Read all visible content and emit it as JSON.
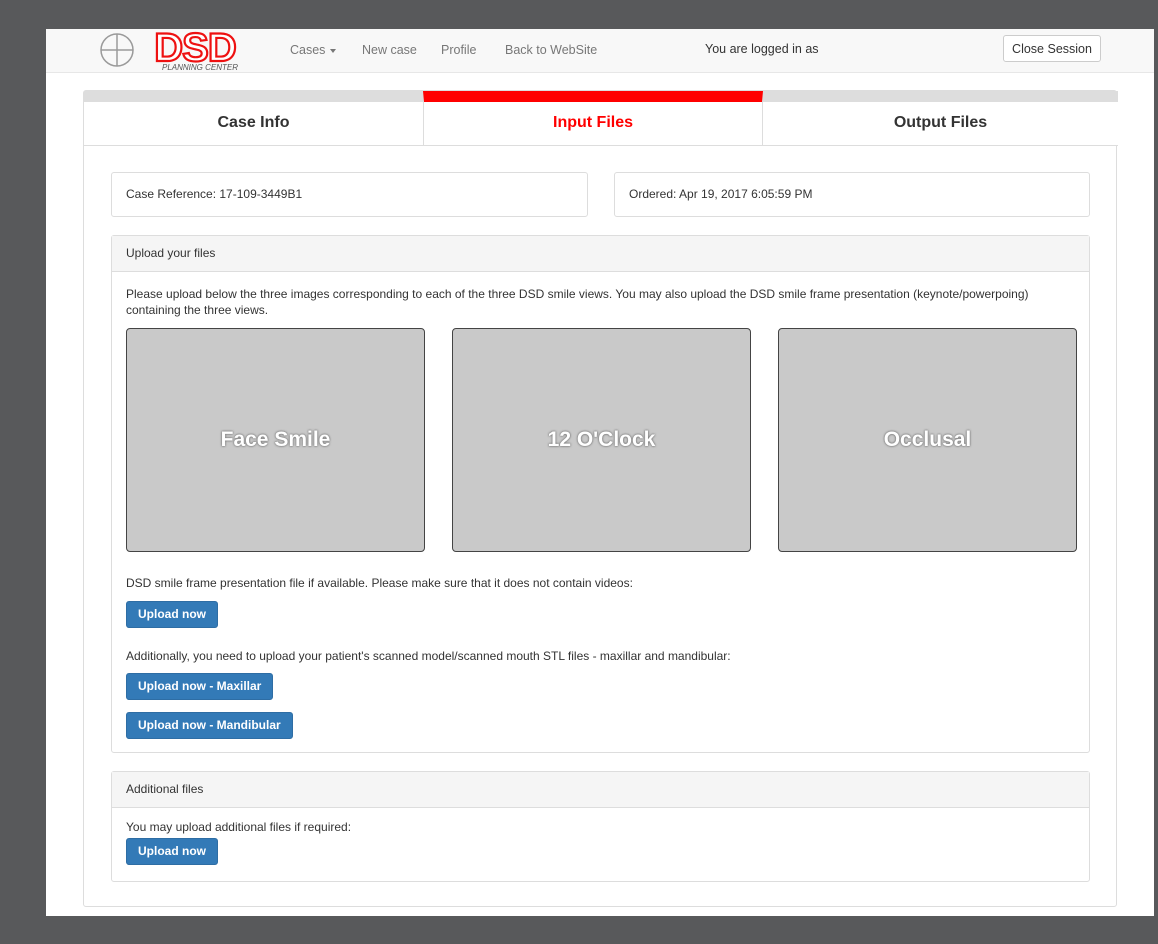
{
  "navbar": {
    "logo_text": "DSD",
    "logo_subtext": "PLANNING CENTER",
    "cases_label": "Cases",
    "new_case_label": "New case",
    "profile_label": "Profile",
    "back_label": "Back to WebSite",
    "logged_in_text": "You are logged in as",
    "close_session_label": "Close Session"
  },
  "tabs": [
    {
      "label": "Case Info",
      "active": false
    },
    {
      "label": "Input Files",
      "active": true
    },
    {
      "label": "Output Files",
      "active": false
    }
  ],
  "case_info": {
    "reference": "Case Reference: 17-109-3449B1",
    "ordered": "Ordered: Apr 19, 2017 6:05:59 PM"
  },
  "upload_panel": {
    "heading": "Upload your files",
    "intro_line1": "Please upload below the three images corresponding to each of the three DSD smile views. You may also upload the DSD smile frame presentation (keynote/powerpoing)",
    "intro_line2": "containing the three views.",
    "dropzones": [
      "Face Smile",
      "12 O'Clock",
      "Occlusal"
    ],
    "presentation_text": "DSD smile frame presentation file if available. Please make sure that it does not contain videos:",
    "upload_now_label": "Upload now",
    "stl_text": "Additionally, you need to upload your patient's scanned model/scanned mouth STL files - maxillar and mandibular:",
    "upload_maxillar_label": "Upload now - Maxillar",
    "upload_mandibular_label": "Upload now - Mandibular"
  },
  "additional_panel": {
    "heading": "Additional files",
    "text": "You may upload additional files if required:",
    "upload_now_label": "Upload now"
  },
  "colors": {
    "accent_red": "#ff0000",
    "primary_blue": "#337ab7",
    "backdrop": "#58595b"
  }
}
